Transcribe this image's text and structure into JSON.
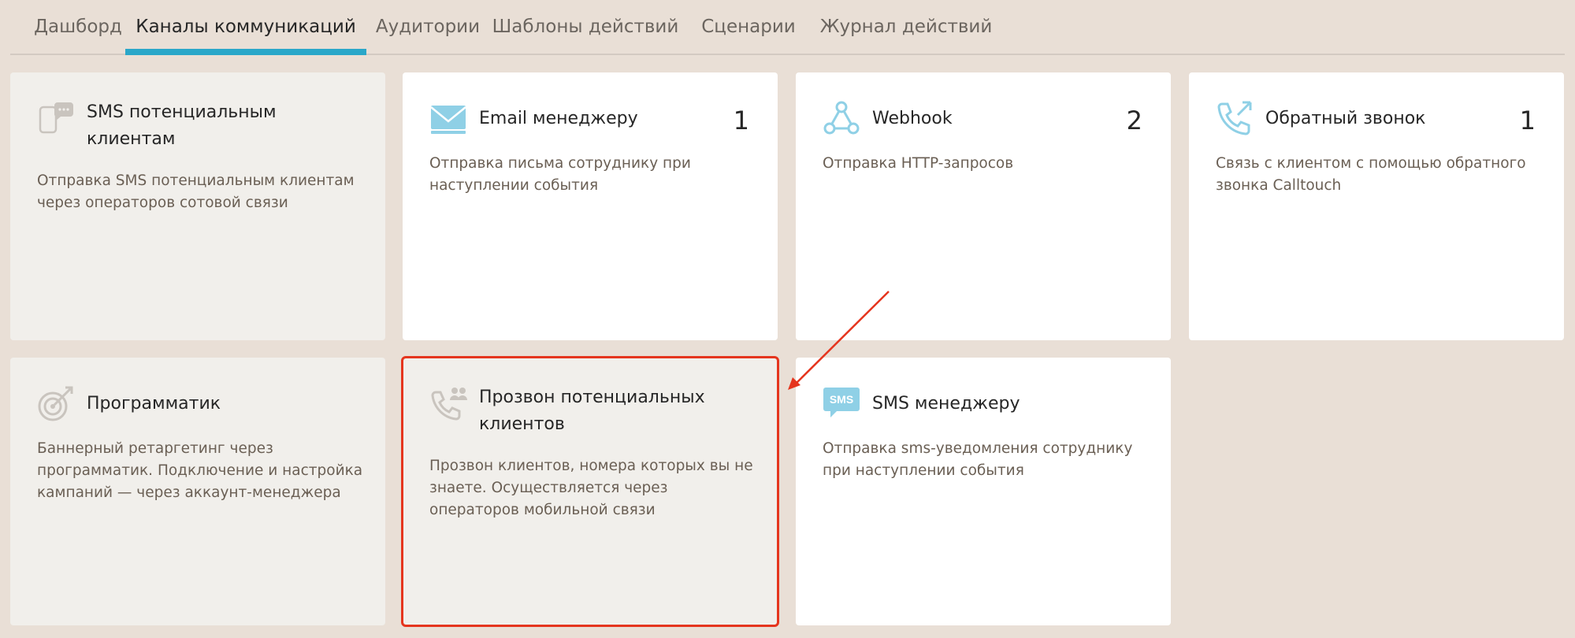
{
  "tabs": [
    {
      "label": "Дашборд"
    },
    {
      "label": "Каналы коммуникаций",
      "active": true
    },
    {
      "label": "Аудитории"
    },
    {
      "label": "Шаблоны действий"
    },
    {
      "label": "Сценарии"
    },
    {
      "label": "Журнал действий"
    }
  ],
  "cards": [
    {
      "title": "SMS потенциальным клиентам",
      "count": "",
      "desc": "Отправка SMS потенциальным клиентам через операторов сотовой связи",
      "icon": "sms-bubble-icon",
      "muted": true
    },
    {
      "title": "Email менеджеру",
      "count": "1",
      "desc": "Отправка письма сотруднику при наступлении события",
      "icon": "email-icon",
      "muted": false
    },
    {
      "title": "Webhook",
      "count": "2",
      "desc": "Отправка HTTP-запросов",
      "icon": "webhook-icon",
      "muted": false
    },
    {
      "title": "Обратный звонок",
      "count": "1",
      "desc": "Связь с клиентом с помощью обратного звонка Calltouch",
      "icon": "callback-phone-icon",
      "muted": false
    },
    {
      "title": "Программатик",
      "count": "",
      "desc": "Баннерный ретаргетинг через программатик. Подключение и настройка кампаний — через аккаунт-менеджера",
      "icon": "target-icon",
      "muted": true
    },
    {
      "title": "Прозвон потенциальных клиентов",
      "count": "",
      "desc": "Прозвон клиентов, номера которых вы не знаете. Осуществляется через операторов мобильной связи",
      "icon": "phone-people-icon",
      "muted": true
    },
    {
      "title": "SMS менеджеру",
      "count": "",
      "desc": "Отправка sms-уведомления сотруднику при наступлении события",
      "icon": "sms-badge-icon",
      "muted": false
    }
  ],
  "icon_labels": {
    "sms_badge": "SMS"
  },
  "colors": {
    "accent": "#2aa7c9",
    "icon": "#8fd0e6",
    "icon_muted": "#c9c4be",
    "highlight": "#e5351e",
    "background": "#e9dfd6"
  }
}
